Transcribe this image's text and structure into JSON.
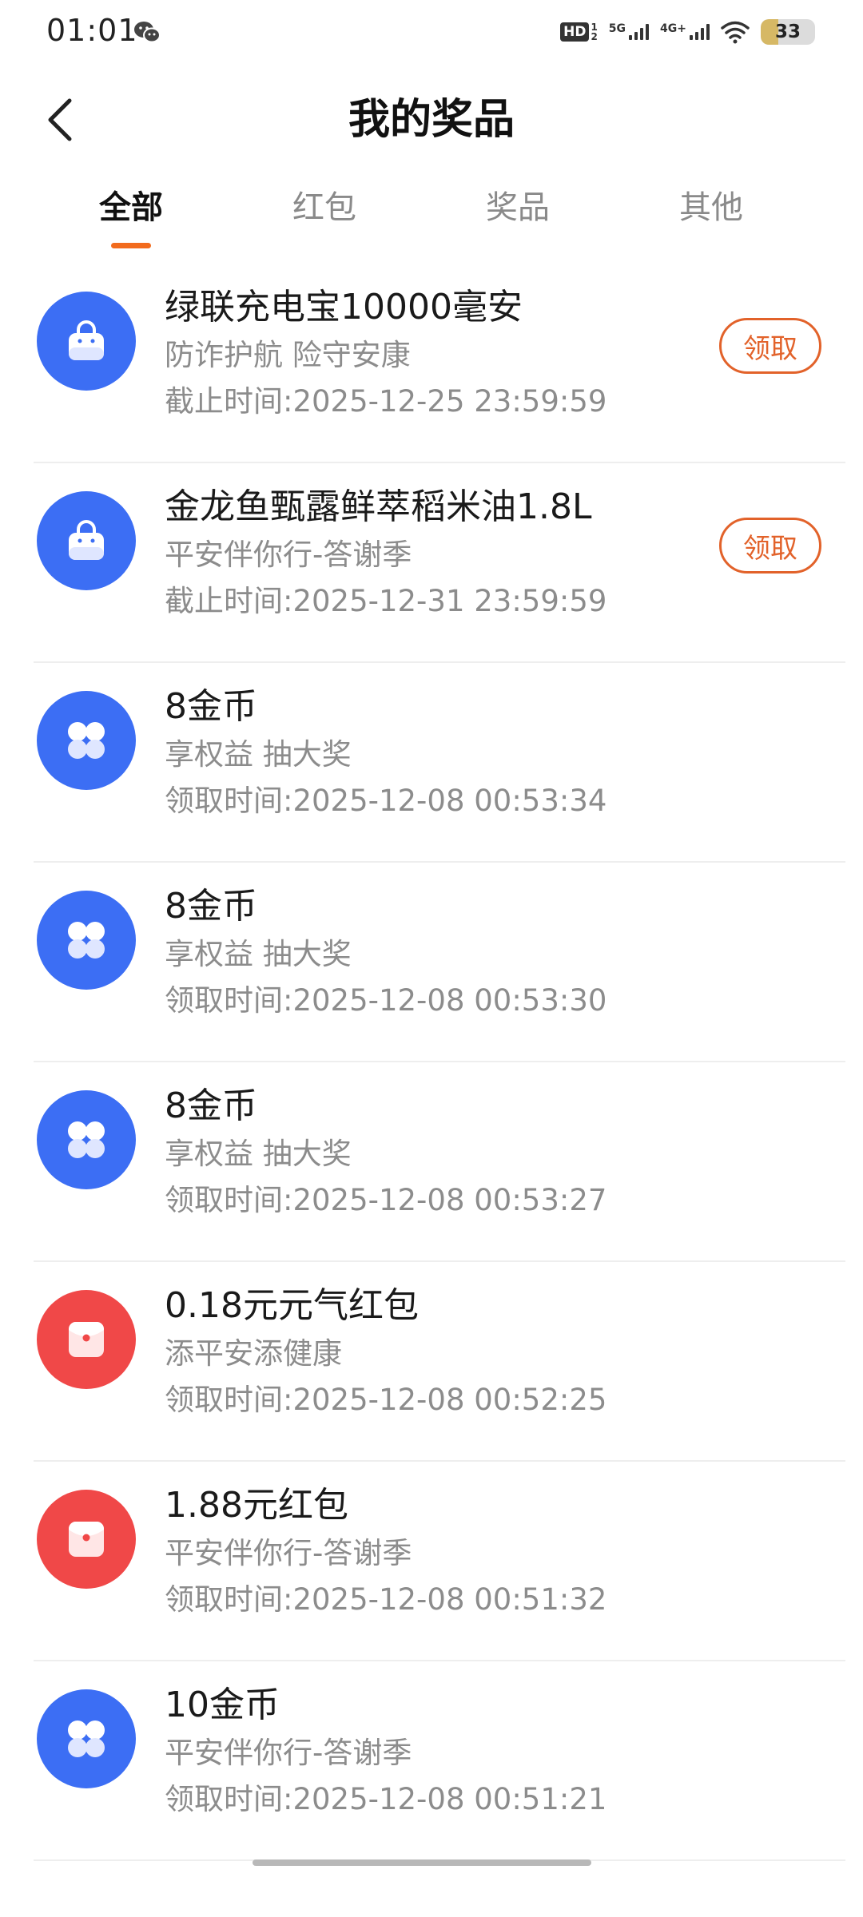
{
  "status_bar": {
    "time": "01:01",
    "hd_label": "HD",
    "hd_sub_top": "1",
    "hd_sub_bottom": "2",
    "net1_label": "5G",
    "net2_label": "4G+",
    "battery": "33",
    "battery_level": 0.33
  },
  "header": {
    "title": "我的奖品"
  },
  "tabs": [
    {
      "label": "全部",
      "active": true
    },
    {
      "label": "红包",
      "active": false
    },
    {
      "label": "奖品",
      "active": false
    },
    {
      "label": "其他",
      "active": false
    }
  ],
  "items": [
    {
      "title": "绿联充电宝10000毫安",
      "subtitle": "防诈护航 险守安康",
      "time": "截止时间:2025-12-25 23:59:59",
      "icon": "shopping-bag-icon",
      "color": "#3c6ef4",
      "button": "领取"
    },
    {
      "title": "金龙鱼甄露鲜萃稻米油1.8L",
      "subtitle": "平安伴你行-答谢季",
      "time": "截止时间:2025-12-31 23:59:59",
      "icon": "shopping-bag-icon",
      "color": "#3c6ef4",
      "button": "领取"
    },
    {
      "title": "8金币",
      "subtitle": "享权益 抽大奖",
      "time": "领取时间:2025-12-08 00:53:34",
      "icon": "coins-icon",
      "color": "#3c6ef4",
      "button": ""
    },
    {
      "title": "8金币",
      "subtitle": "享权益 抽大奖",
      "time": "领取时间:2025-12-08 00:53:30",
      "icon": "coins-icon",
      "color": "#3c6ef4",
      "button": ""
    },
    {
      "title": "8金币",
      "subtitle": "享权益 抽大奖",
      "time": "领取时间:2025-12-08 00:53:27",
      "icon": "coins-icon",
      "color": "#3c6ef4",
      "button": ""
    },
    {
      "title": "0.18元元气红包",
      "subtitle": "添平安添健康",
      "time": "领取时间:2025-12-08 00:52:25",
      "icon": "red-envelope-icon",
      "color": "#f04848",
      "button": ""
    },
    {
      "title": "1.88元红包",
      "subtitle": "平安伴你行-答谢季",
      "time": "领取时间:2025-12-08 00:51:32",
      "icon": "red-envelope-icon",
      "color": "#f04848",
      "button": ""
    },
    {
      "title": "10金币",
      "subtitle": "平安伴你行-答谢季",
      "time": "领取时间:2025-12-08 00:51:21",
      "icon": "coins-icon",
      "color": "#3c6ef4",
      "button": ""
    }
  ]
}
